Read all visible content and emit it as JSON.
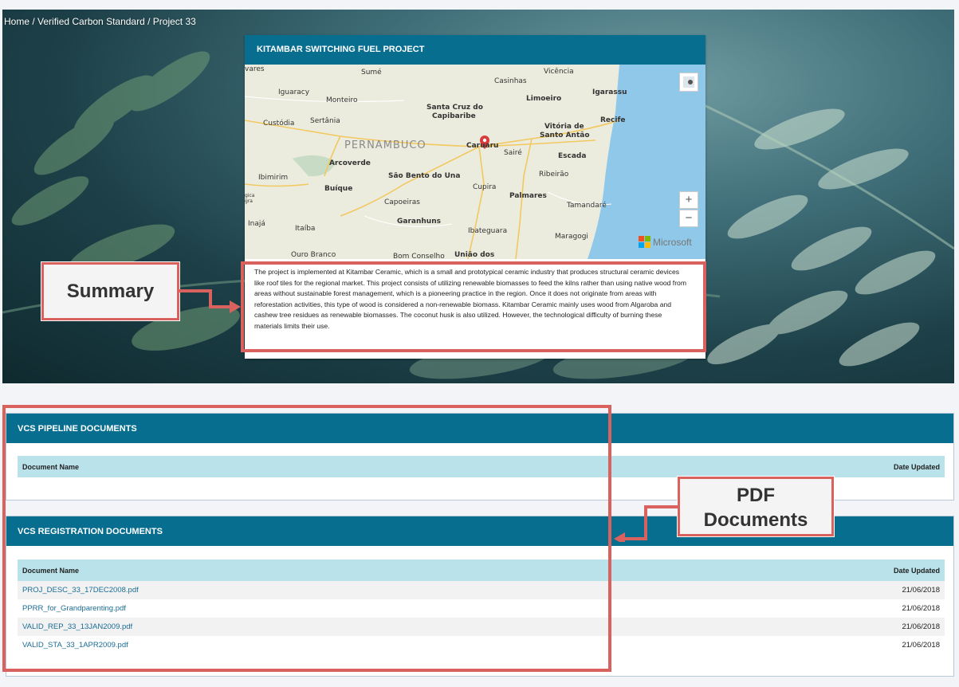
{
  "breadcrumb": "Home / Verified Carbon Standard / Project 33",
  "project": {
    "title": "KITAMBAR SWITCHING FUEL PROJECT",
    "summary": "The project is implemented at Kitambar Ceramic, which is a small and prototypical ceramic industry that produces structural ceramic devices like roof tiles for the regional market. This project consists of utilizing renewable biomasses to feed the kilns rather than using native wood from areas without sustainable forest management, which is a pioneering practice in the region. Once it does not originate from areas with reforestation activities, this type of wood is considered a non-renewable biomass. Kitambar Ceramic mainly uses wood from Algaroba and cashew tree residues as renewable biomasses. The coconut husk is also utilized. However, the technological difficulty of burning these materials limits their use."
  },
  "map": {
    "region": "PERNAMBUCO",
    "places": [
      "vares",
      "Sumé",
      "Vicência",
      "Casinhas",
      "Iguaracy",
      "Monteiro",
      "Limoeiro",
      "Igarassu",
      "Santa Cruz do",
      "Capibaribe",
      "Custódia",
      "Sertânia",
      "Vitória de",
      "Santo Antão",
      "Recife",
      "Caruaru",
      "Sairé",
      "Escada",
      "Arcoverde",
      "Ibimirim",
      "São Bento do Una",
      "Ribeirão",
      "Buíque",
      "Cupira",
      "Palmares",
      "Capoeiras",
      "Tamandaré",
      "Inajá",
      "Itaíba",
      "Garanhuns",
      "Ibateguara",
      "Maragogi",
      "Ouro Branco",
      "Bom Conselho",
      "União dos",
      "gica",
      "gra"
    ],
    "zoom_in": "+",
    "zoom_out": "−",
    "attribution": "Microsoft"
  },
  "annotations": {
    "summary": "Summary",
    "pdf_line1": "PDF",
    "pdf_line2": "Documents"
  },
  "pipeline": {
    "title": "VCS PIPELINE DOCUMENTS",
    "col_name": "Document Name",
    "col_date": "Date Updated"
  },
  "registration": {
    "title": "VCS REGISTRATION DOCUMENTS",
    "col_name": "Document Name",
    "col_date": "Date Updated",
    "rows": [
      {
        "name": "PROJ_DESC_33_17DEC2008.pdf",
        "date": "21/06/2018"
      },
      {
        "name": "PPRR_for_Grandparenting.pdf",
        "date": "21/06/2018"
      },
      {
        "name": "VALID_REP_33_13JAN2009.pdf",
        "date": "21/06/2018"
      },
      {
        "name": "VALID_STA_33_1APR2009.pdf",
        "date": "21/06/2018"
      }
    ]
  },
  "colors": {
    "header": "#086e8f",
    "table_head": "#b9e2ea",
    "annotation": "#d9625e",
    "link": "#1b6c96"
  }
}
